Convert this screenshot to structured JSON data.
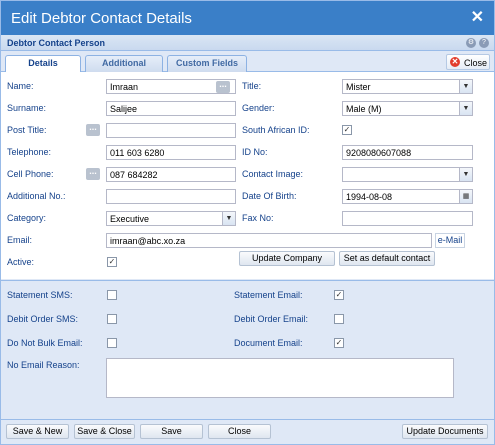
{
  "window": {
    "title": "Edit Debtor Contact Details",
    "close_glyph": "✕"
  },
  "panel": {
    "title": "Debtor Contact Person"
  },
  "tabs": [
    {
      "label": "Details"
    },
    {
      "label": "Additional"
    },
    {
      "label": "Custom Fields"
    }
  ],
  "close_button": {
    "label": "Close"
  },
  "form": {
    "name_label": "Name:",
    "name_value": "Imraan",
    "surname_label": "Surname:",
    "surname_value": "Salijee",
    "post_title_label": "Post Title:",
    "post_title_value": "",
    "telephone_label": "Telephone:",
    "telephone_value": "011 603 6280",
    "cell_label": "Cell Phone:",
    "cell_value": "087 684282",
    "additional_no_label": "Additional No.:",
    "additional_no_value": "",
    "category_label": "Category:",
    "category_value": "Executive",
    "email_label": "Email:",
    "email_value": "imraan@abc.xo.za",
    "email_link": "e-Mail",
    "active_label": "Active:",
    "active_checked": true,
    "title_label": "Title:",
    "title_value": "Mister",
    "gender_label": "Gender:",
    "gender_value": "Male (M)",
    "sa_id_label": "South African ID:",
    "sa_id_checked": true,
    "id_no_label": "ID No:",
    "id_no_value": "9208080607088",
    "contact_image_label": "Contact Image:",
    "contact_image_value": "",
    "dob_label": "Date Of Birth:",
    "dob_value": "1994-08-08",
    "fax_label": "Fax No:",
    "fax_value": "",
    "update_company": "Update Company",
    "set_default": "Set as default contact"
  },
  "lower": {
    "statement_sms_label": "Statement SMS:",
    "statement_sms_checked": false,
    "debit_order_sms_label": "Debit Order SMS:",
    "debit_order_sms_checked": false,
    "do_not_bulk_label": "Do Not Bulk Email:",
    "do_not_bulk_checked": false,
    "no_email_reason_label": "No Email Reason:",
    "no_email_reason_value": "",
    "statement_email_label": "Statement Email:",
    "statement_email_checked": true,
    "debit_order_email_label": "Debit Order Email:",
    "debit_order_email_checked": false,
    "document_email_label": "Document Email:",
    "document_email_checked": true
  },
  "footer": {
    "save_new": "Save & New",
    "save_close": "Save & Close",
    "save": "Save",
    "close": "Close",
    "update_documents": "Update Documents"
  },
  "glyphs": {
    "check": "✓",
    "dropdown": "▼",
    "dots": "...",
    "gear": "⚙",
    "help": "?",
    "close_x": "✕"
  },
  "colors": {
    "titlebar": "#3a7fc8",
    "panel_bg": "#dfe8f6",
    "label": "#15428b",
    "close_icon": "#e23c2c"
  }
}
